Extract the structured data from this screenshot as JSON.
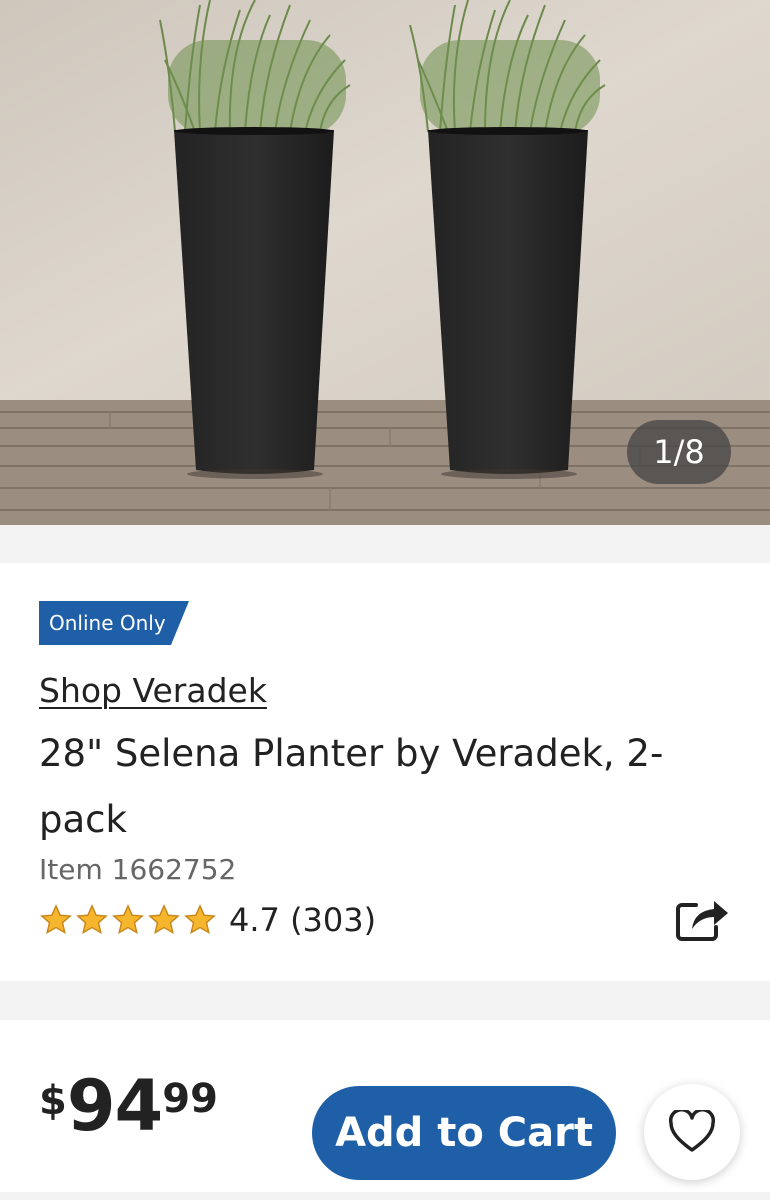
{
  "gallery": {
    "counter": "1/8",
    "image_alt": "Two tall black planters with grass"
  },
  "product": {
    "badge": "Online Only",
    "brand_link": "Shop Veradek",
    "title": "28\" Selena Planter by Veradek, 2-pack",
    "item_number": "Item 1662752",
    "rating": {
      "stars": 5,
      "text": "4.7 (303)"
    }
  },
  "purchase": {
    "price_currency": "$",
    "price_dollars": "94",
    "price_cents": "99",
    "add_to_cart_label": "Add to Cart"
  },
  "colors": {
    "brand_blue": "#1f5fa8",
    "star": "#f5b52c"
  },
  "icons": [
    "share-icon",
    "heart-icon",
    "star-icon"
  ]
}
